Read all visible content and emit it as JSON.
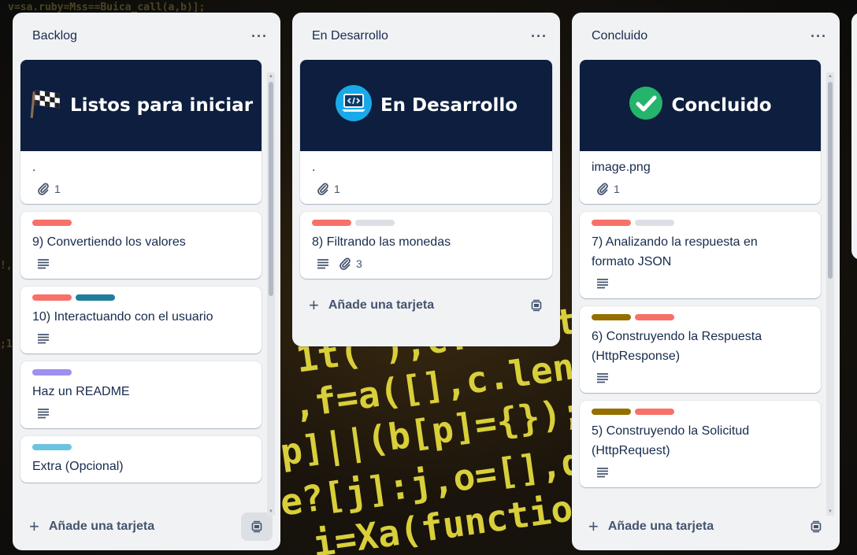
{
  "lists": [
    {
      "title": "Backlog",
      "cards": [
        {
          "cover_title": "Listos para iniciar",
          "cover_icon": "checkered-flag",
          "title": ".",
          "attachments": "1"
        },
        {
          "labels": [
            "#f87168"
          ],
          "title": "9) Convertiendo los valores",
          "has_description": true
        },
        {
          "labels": [
            "#f87168",
            "#227d9b"
          ],
          "title": "10) Interactuando con el usuario",
          "has_description": true
        },
        {
          "labels": [
            "#9f8fef"
          ],
          "title": "Haz un README",
          "has_description": true
        },
        {
          "labels": [
            "#6cc3e0"
          ],
          "title": "Extra (Opcional)"
        }
      ],
      "add_card_label": "Añade una tarjeta"
    },
    {
      "title": "En Desarrollo",
      "cards": [
        {
          "cover_title": "En Desarrollo",
          "cover_icon": "laptop-code",
          "title": ".",
          "attachments": "1"
        },
        {
          "labels": [
            "#f87168",
            "#dcdfe4"
          ],
          "title": "8) Filtrando las monedas",
          "has_description": true,
          "attachments": "3"
        }
      ],
      "add_card_label": "Añade una tarjeta"
    },
    {
      "title": "Concluido",
      "cards": [
        {
          "cover_title": "Concluido",
          "cover_icon": "check-circle",
          "title": "image.png",
          "attachments": "1"
        },
        {
          "labels": [
            "#f87168",
            "#dcdfe4"
          ],
          "title_lines": [
            "7) Analizando la respuesta en",
            "formato JSON"
          ],
          "has_description": true
        },
        {
          "labels": [
            "#946f00",
            "#f87168"
          ],
          "title_lines": [
            "6) Construyendo la Respuesta",
            "(HttpResponse)"
          ],
          "has_description": true
        },
        {
          "labels": [
            "#946f00",
            "#f87168"
          ],
          "title_lines": [
            "5) Construyendo la Solicitud",
            "(HttpRequest)"
          ],
          "has_description": true
        }
      ],
      "add_card_label": "Añade una tarjeta"
    }
  ],
  "menu_glyph": "···",
  "colors": {
    "cover_bg": "#0d1e3f",
    "list_bg": "#f1f2f4"
  }
}
